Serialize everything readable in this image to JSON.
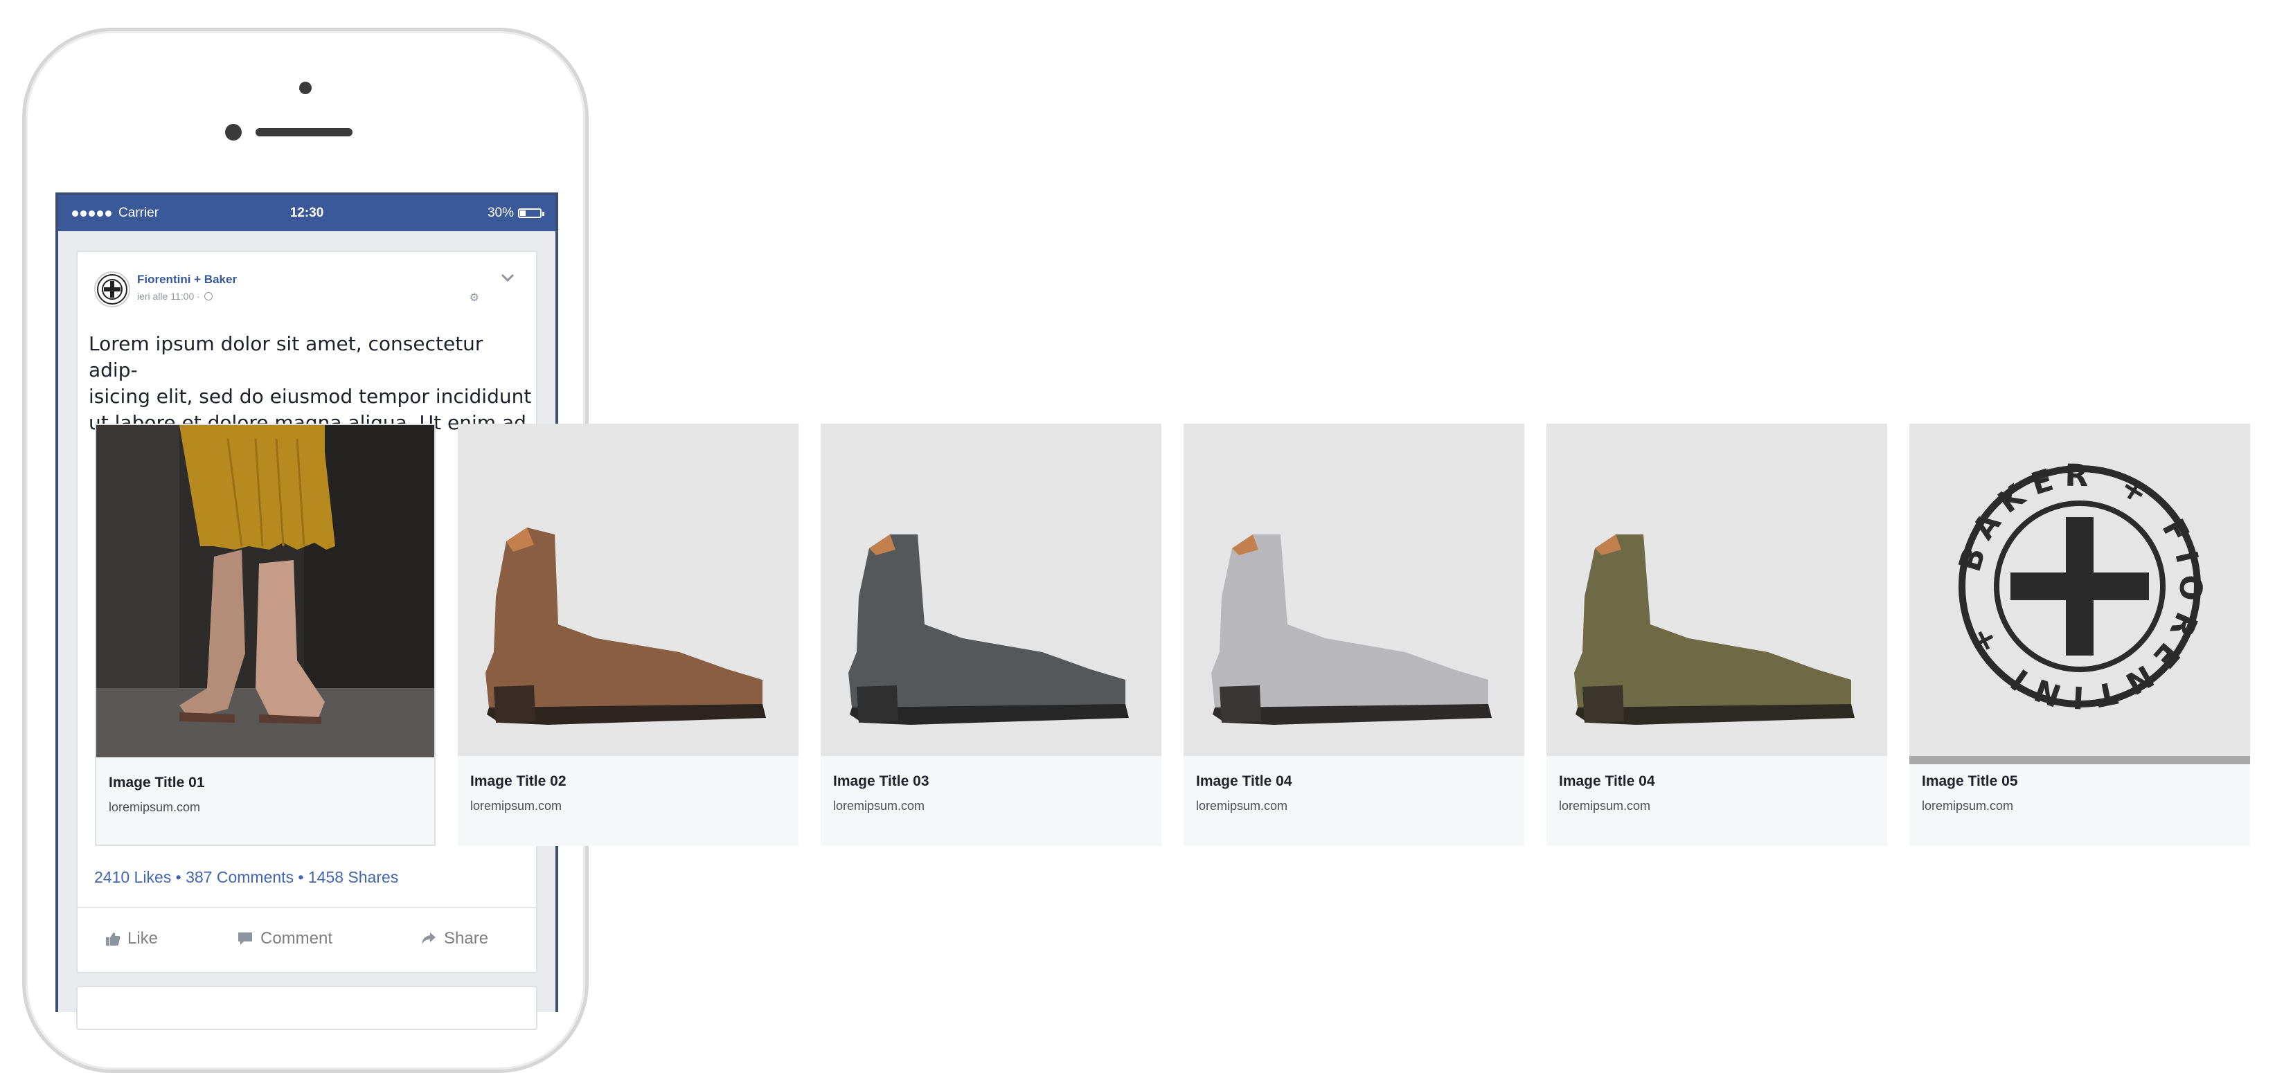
{
  "status_bar": {
    "carrier": "Carrier",
    "time": "12:30",
    "battery": "30%",
    "battery_level": 0.3
  },
  "post": {
    "page_name": "Fiorentini + Baker",
    "timestamp": "ieri alle 11:00 · ",
    "text": "Lorem ipsum dolor sit amet, consectetur adip- isicing elit, sed do eiusmod tempor incididunt ut labore et dolore magna aliqua. Ut enim ad",
    "text_lines": [
      "Lorem ipsum dolor sit amet, consectetur adip-",
      "isicing elit, sed do eiusmod tempor incididunt",
      "ut labore et dolore magna aliqua. Ut enim ad"
    ],
    "engagement": "2410 Likes • 387 Comments • 1458 Shares",
    "actions": {
      "like": "Like",
      "comment": "Comment",
      "share": "Share"
    }
  },
  "carousel": [
    {
      "title": "Image Title 01",
      "url": "loremipsum.com",
      "image": "model-wearing-boots-photo"
    },
    {
      "title": "Image Title 02",
      "url": "loremipsum.com",
      "image": "brown-boot-photo",
      "color": "#8a5e42"
    },
    {
      "title": "Image Title 03",
      "url": "loremipsum.com",
      "image": "grey-boot-photo",
      "color": "#55585a"
    },
    {
      "title": "Image Title 04",
      "url": "loremipsum.com",
      "image": "silver-boot-photo",
      "color": "#b8b8bc"
    },
    {
      "title": "Image Title 04",
      "url": "loremipsum.com",
      "image": "olive-boot-photo",
      "color": "#6d6a45"
    },
    {
      "title": "Image Title 05",
      "url": "loremipsum.com",
      "image": "brand-logo"
    }
  ],
  "logo_text": "BAKER + FIORENTINI +",
  "colors": {
    "facebook_blue": "#3b5998",
    "link_blue": "#4267b2",
    "card_bg": "#f6f7f9"
  }
}
